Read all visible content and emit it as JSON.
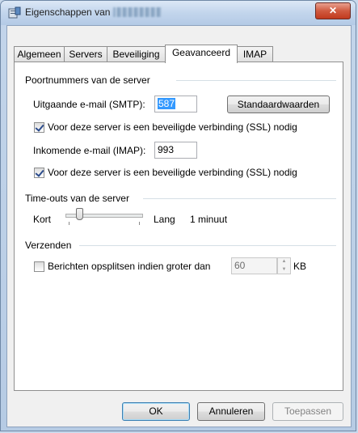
{
  "window": {
    "title": "Eigenschappen van",
    "close_glyph": "✕"
  },
  "tabs": [
    {
      "label": "Algemeen",
      "active": false
    },
    {
      "label": "Servers",
      "active": false
    },
    {
      "label": "Beveiliging",
      "active": false
    },
    {
      "label": "Geavanceerd",
      "active": true
    },
    {
      "label": "IMAP",
      "active": false
    }
  ],
  "ports": {
    "group_title": "Poortnummers van de server",
    "smtp_label": "Uitgaande e-mail (SMTP):",
    "smtp_value": "587",
    "defaults_button": "Standaardwaarden",
    "smtp_ssl_label": "Voor deze server is een beveiligde verbinding (SSL) nodig",
    "smtp_ssl_checked": true,
    "imap_label": "Inkomende e-mail (IMAP):",
    "imap_value": "993",
    "imap_ssl_label": "Voor deze server is een beveiligde verbinding (SSL) nodig",
    "imap_ssl_checked": true
  },
  "timeouts": {
    "group_title": "Time-outs van de server",
    "short_label": "Kort",
    "long_label": "Lang",
    "value_text": "1 minuut",
    "slider_fraction": 0.15
  },
  "sending": {
    "group_title": "Verzenden",
    "split_label": "Berichten opsplitsen indien groter dan",
    "split_checked": false,
    "split_value": "60",
    "unit": "KB"
  },
  "buttons": {
    "ok": "OK",
    "cancel": "Annuleren",
    "apply": "Toepassen"
  },
  "colors": {
    "selection": "#3399ff",
    "close_button": "#c13a1e"
  }
}
